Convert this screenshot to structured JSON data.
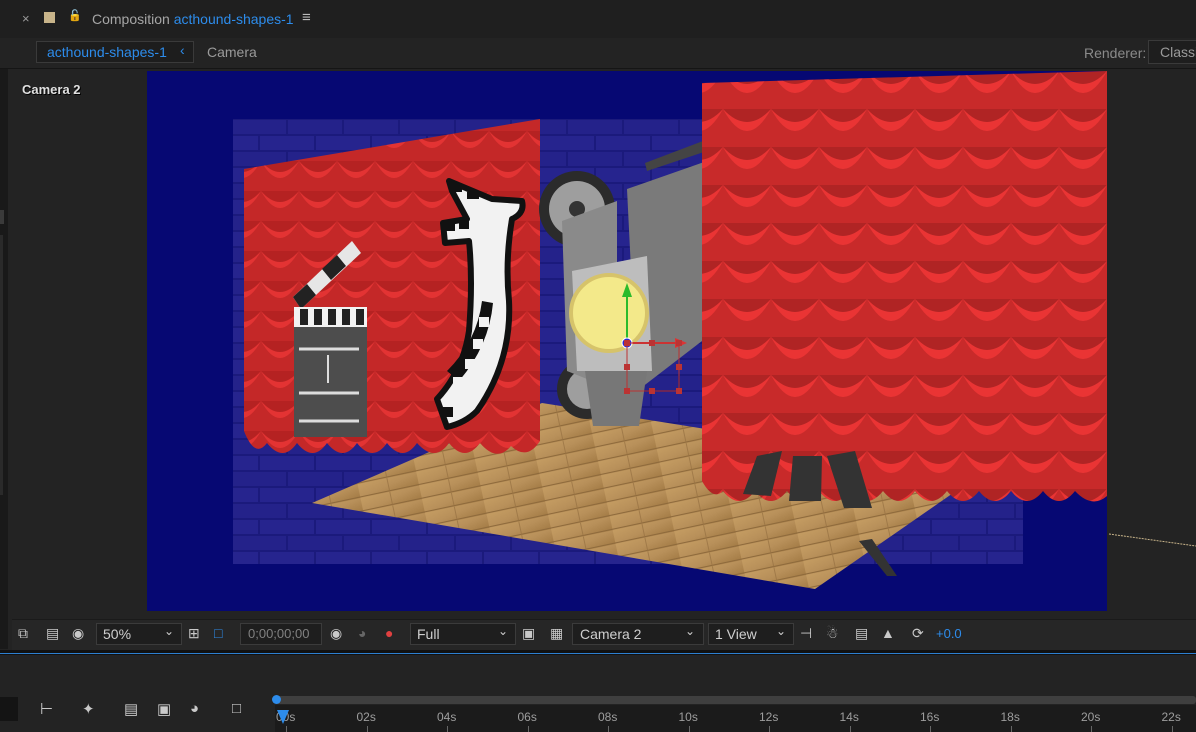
{
  "header": {
    "close_icon": "×",
    "title_prefix": "Composition",
    "comp_name": "acthound-shapes-1",
    "menu_icon": "≡"
  },
  "tabs": {
    "active_tab": "acthound-shapes-1",
    "camera_tab": "Camera",
    "renderer_label": "Renderer:",
    "renderer_value": "Classic"
  },
  "viewer": {
    "camera_label": "Camera 2"
  },
  "toolbar": {
    "zoom": "50%",
    "timecode": "0;00;00;00",
    "resolution": "Full",
    "camera_view": "Camera 2",
    "view_layout": "1 View",
    "exposure": "+0.0",
    "accent_color": "#2d8ceb"
  },
  "timeline": {
    "ticks": [
      "00s",
      "02s",
      "04s",
      "06s",
      "08s",
      "10s",
      "12s",
      "14s",
      "16s",
      "18s",
      "20s",
      "22s"
    ]
  }
}
